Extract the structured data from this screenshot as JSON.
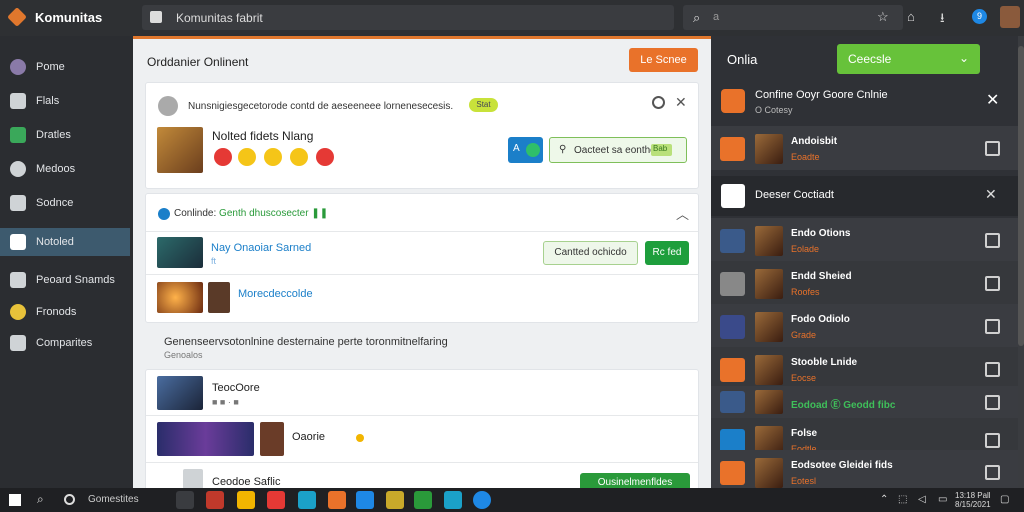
{
  "app": {
    "title": "Komunitas"
  },
  "address_bar": {
    "text": "Komunitas fabrit"
  },
  "search": {
    "placeholder": "a"
  },
  "top_icons": [
    "star-icon",
    "home-icon",
    "download-icon",
    "user-badge-icon"
  ],
  "user_badge": "9",
  "sidebar": {
    "items": [
      {
        "label": "Pome",
        "icon": "avatar-icon"
      },
      {
        "label": "Flals",
        "icon": "chart-icon"
      },
      {
        "label": "Dratles",
        "icon": "robot-icon"
      },
      {
        "label": "Medoos",
        "icon": "chat-icon"
      },
      {
        "label": "Sodnce",
        "icon": "grid-icon"
      },
      {
        "label": "Notoled",
        "icon": "house-icon",
        "active": true
      },
      {
        "label": "Peoard Snamds",
        "icon": "star-icon"
      },
      {
        "label": "Fronods",
        "icon": "coin-icon"
      },
      {
        "label": "Comparites",
        "icon": "briefcase-icon"
      }
    ]
  },
  "main": {
    "title": "Orddanier Onlinent",
    "header_button": "Le Scnee",
    "card1": {
      "text": "Nunsnigiesgecetorode contd de aeseeneee lornenesecesis.",
      "pill": "Stat",
      "item_name": "Nolted fidets Nlang",
      "blue_btn": "A",
      "button": "Oacteet sa eonthe",
      "button_tag": "Bab"
    },
    "card2": {
      "title_prefix": "Conlinde:",
      "title_green": "Genth dhuscosecter",
      "row1_title": "Nay Onaoiar Sarned",
      "row1_sub": "ft",
      "btn_a": "Cantted ochicdo",
      "btn_b": "Rc fed",
      "row2_title": "Morecdeccolde"
    },
    "section_title": "Genenseervsotonlnine desternaine perte toronmitnelfaring",
    "section_sub": "Genoalos",
    "card3": {
      "row1_title": "TeocOore",
      "row1_meta": "■  ■ · ■",
      "row2_title": "Oaorie",
      "row3_title": "Ceodoe Saflic",
      "btn": "Ousinelmenfldes"
    }
  },
  "right_panel": {
    "title": "Onlia",
    "button": "Ceecsle",
    "notification": {
      "title": "Confine Ooyr Goore Cnlnie",
      "sub": "O Cotesy"
    },
    "rows_top": [
      {
        "name": "Andoisbit",
        "sub": "Eoadte",
        "icon_color": "#e9722a"
      }
    ],
    "section_title": "Deeser Coctiadt",
    "rows": [
      {
        "name": "Endo Otions",
        "sub": "Eolade",
        "icon_color": "#3a5a8a"
      },
      {
        "name": "Endd Sheied",
        "sub": "Roofes",
        "icon_color": "#888"
      },
      {
        "name": "Fodo Odiolo",
        "sub": "Grade",
        "icon_color": "#3a4a8a"
      },
      {
        "name": "Stooble Lnide",
        "sub": "Eocse",
        "icon_color": "#e9722a"
      },
      {
        "name": "Eodoad Ⓔ Geodd fibc",
        "sub": "",
        "icon_color": "#3a5a8a"
      },
      {
        "name": "Folse",
        "sub": "Eodtle",
        "icon_color": "#1b7fc9"
      },
      {
        "name": "Eodsotee Gleidei fids",
        "sub": "Eotesl",
        "icon_color": "#e9722a"
      }
    ]
  },
  "taskbar": {
    "label": "Gomestites",
    "clock": [
      "13:18 Pall",
      "8/15/2021"
    ]
  },
  "colors": {
    "accent": "#e9722a",
    "primary": "#1b7fc9",
    "success": "#1e9e3c",
    "sidebar_bg": "#2b2d31"
  }
}
